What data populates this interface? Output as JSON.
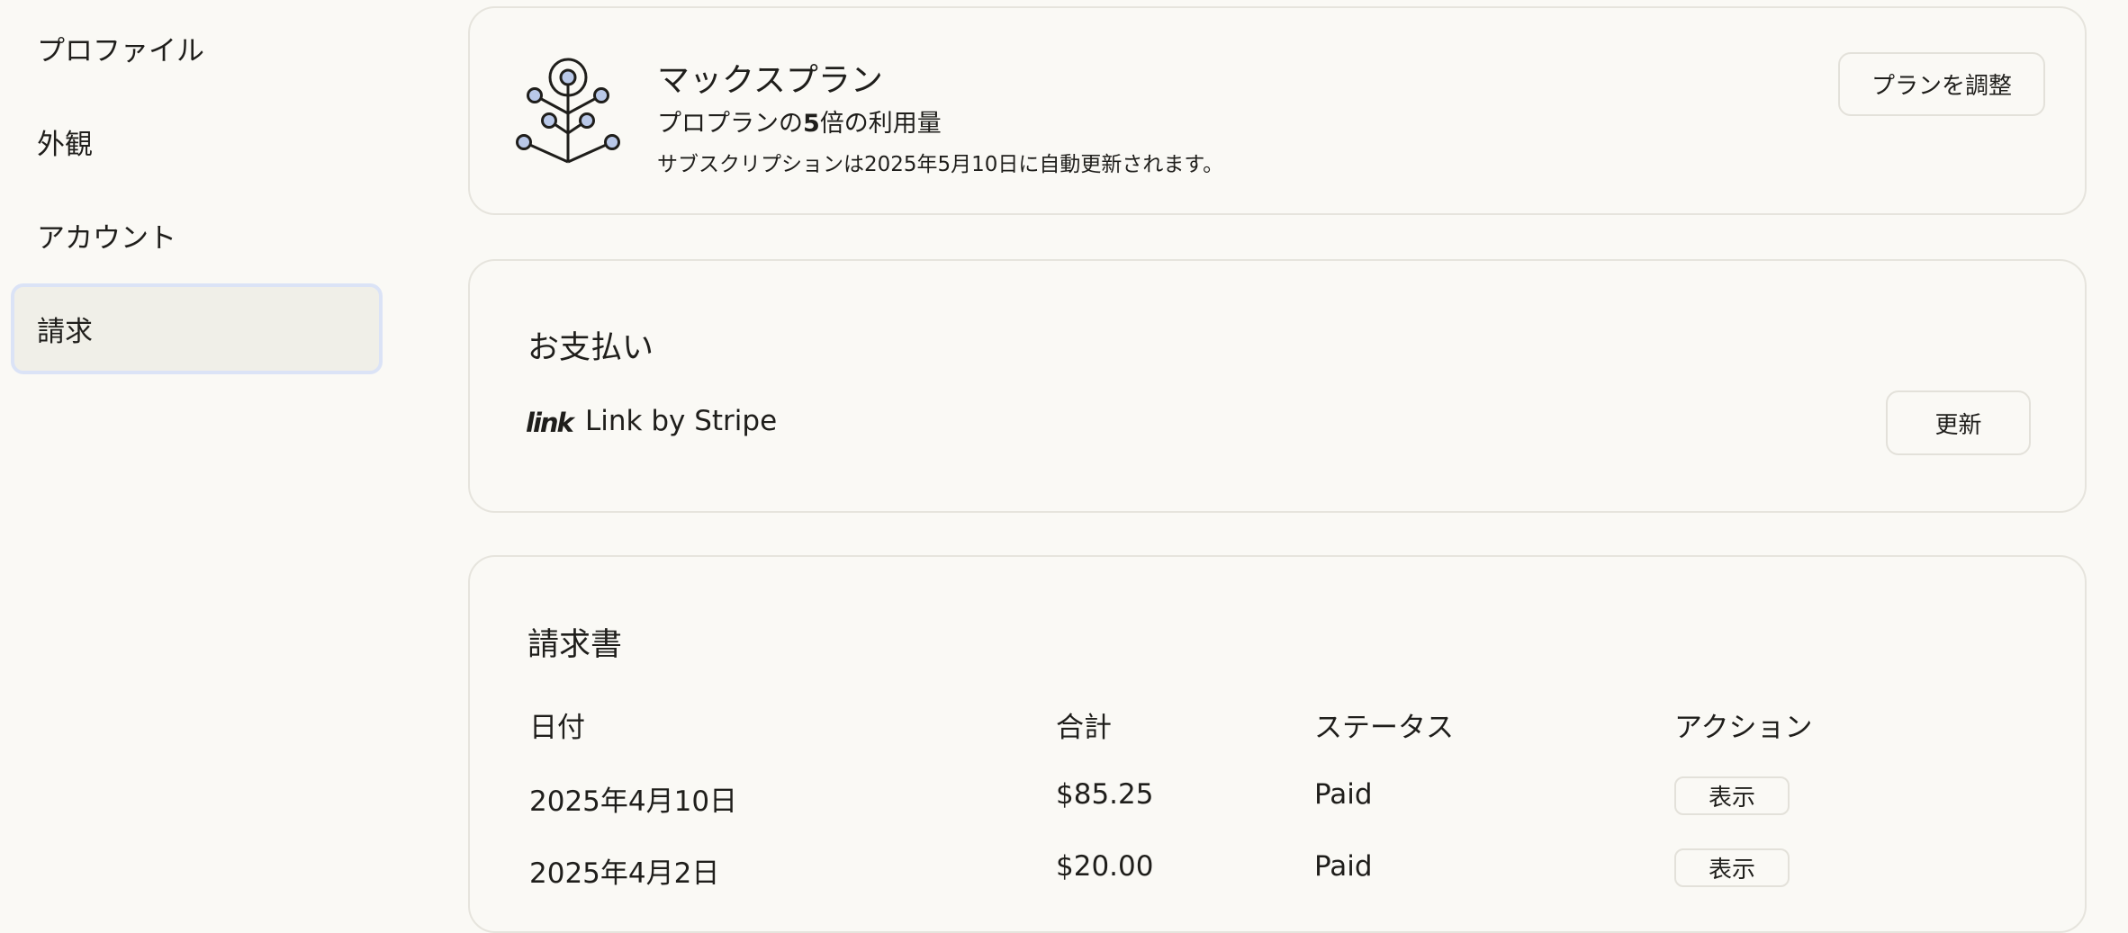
{
  "sidebar": {
    "items": [
      {
        "label": "プロファイル"
      },
      {
        "label": "外観"
      },
      {
        "label": "アカウント"
      },
      {
        "label": "請求",
        "active": true
      }
    ]
  },
  "plan": {
    "icon": "plan-tree-icon",
    "title": "マックスプラン",
    "subtitle_pre": "プロプランの",
    "subtitle_bold": "5",
    "subtitle_post": "倍の利用量",
    "renewal": "サブスクリプションは2025年5月10日に自動更新されます。",
    "adjust_button": "プランを調整"
  },
  "payment": {
    "title": "お支払い",
    "logo_text": "link",
    "method": "Link by Stripe",
    "update_button": "更新"
  },
  "invoices": {
    "title": "請求書",
    "columns": [
      "日付",
      "合計",
      "ステータス",
      "アクション"
    ],
    "rows": [
      {
        "date": "2025年4月10日",
        "total": "$85.25",
        "status": "Paid",
        "action": "表示"
      },
      {
        "date": "2025年4月2日",
        "total": "$20.00",
        "status": "Paid",
        "action": "表示"
      }
    ]
  },
  "colors": {
    "background": "#faf9f5",
    "active_bg": "#f0efe8",
    "focus_ring": "#dbe3f6",
    "icon_fill": "#b9c8e8"
  }
}
